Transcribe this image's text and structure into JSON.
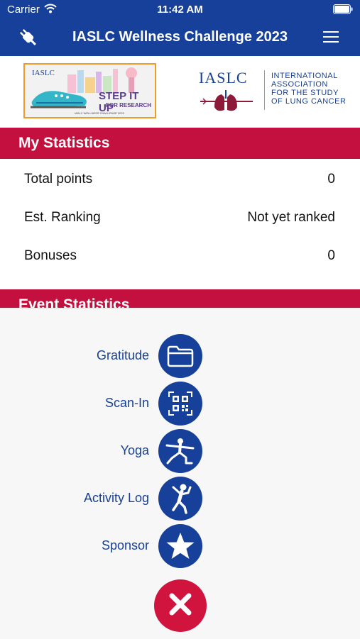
{
  "status": {
    "carrier": "Carrier",
    "time": "11:42 AM"
  },
  "nav": {
    "title": "IASLC Wellness Challenge 2023",
    "left_icon": "plug-icon",
    "right_icon": "hamburger-menu-icon"
  },
  "banner": {
    "event_logo": {
      "org": "IASLC",
      "line1": "STEP IT UP",
      "line2": "FOR RESEARCH",
      "footer": "IASLC WELLNESS CHALLENGE 2023"
    },
    "org_logo": {
      "acronym": "IASLC",
      "name_lines": [
        "INTERNATIONAL",
        "ASSOCIATION",
        "FOR THE STUDY",
        "OF LUNG CANCER"
      ]
    }
  },
  "my_statistics": {
    "title": "My Statistics",
    "rows": [
      {
        "label": "Total points",
        "value": "0"
      },
      {
        "label": "Est. Ranking",
        "value": "Not yet ranked"
      },
      {
        "label": "Bonuses",
        "value": "0"
      }
    ]
  },
  "event_statistics": {
    "title": "Event Statistics"
  },
  "fab_menu": {
    "items": [
      {
        "label": "Gratitude",
        "icon": "folder-icon"
      },
      {
        "label": "Scan-In",
        "icon": "qr-code-icon"
      },
      {
        "label": "Yoga",
        "icon": "yoga-pose-icon"
      },
      {
        "label": "Activity Log",
        "icon": "running-person-icon"
      },
      {
        "label": "Sponsor",
        "icon": "star-icon"
      }
    ],
    "close_icon": "close-x-icon"
  },
  "colors": {
    "nav_blue": "#16409a",
    "header_red": "#c4103e",
    "close_red": "#d0143e",
    "overlay_bg": "#f7f7f7"
  }
}
